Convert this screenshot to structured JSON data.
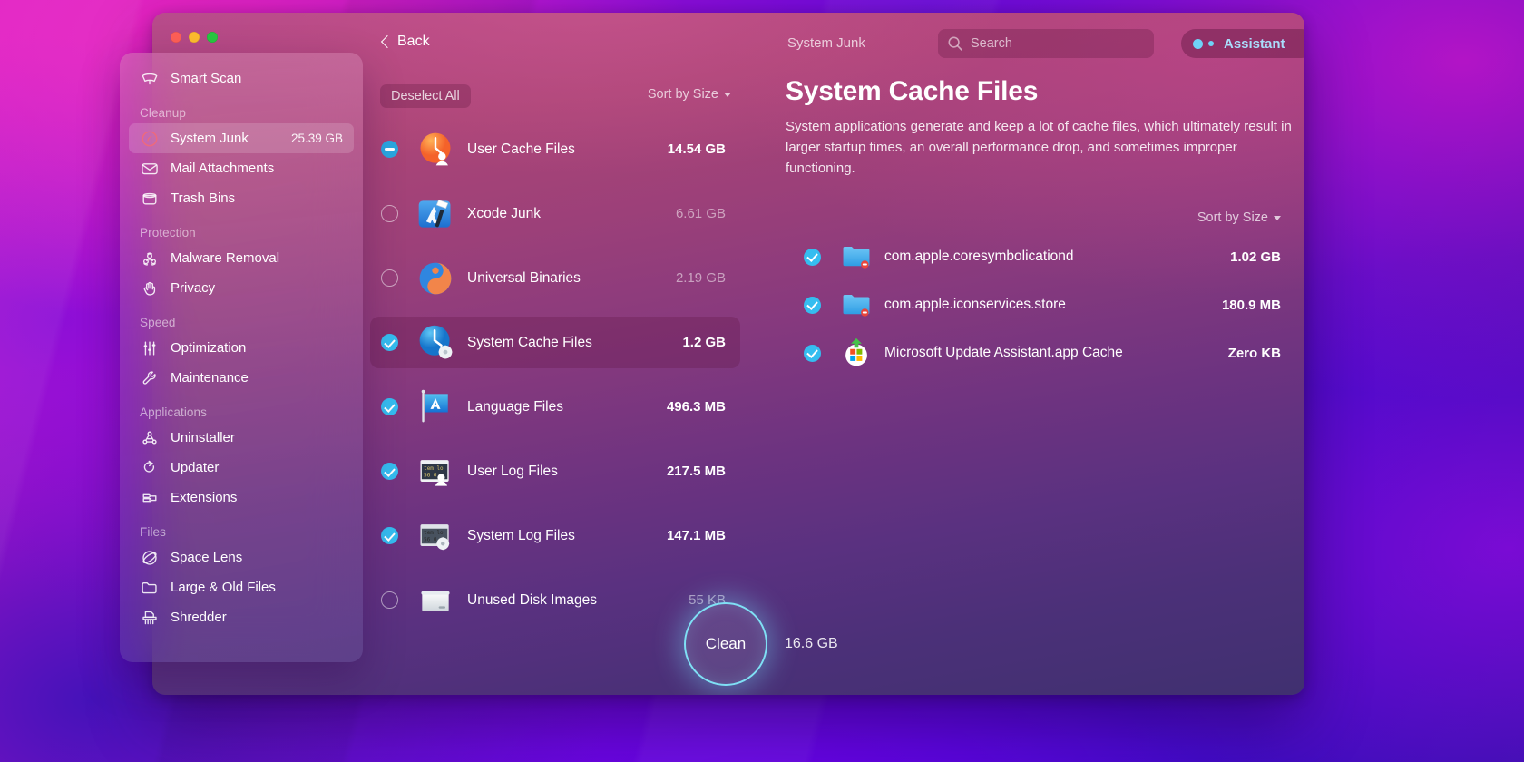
{
  "window": {
    "traffic_lights": [
      "close",
      "minimize",
      "zoom"
    ]
  },
  "topbar": {
    "back_label": "Back",
    "breadcrumb": "System Junk",
    "search_placeholder": "Search",
    "assistant_label": "Assistant"
  },
  "sidebar": {
    "top_item": {
      "label": "Smart Scan",
      "icon": "smart-scan-icon"
    },
    "groups": [
      {
        "title": "Cleanup",
        "items": [
          {
            "label": "System Junk",
            "icon": "system-junk-icon",
            "size": "25.39 GB",
            "selected": true
          },
          {
            "label": "Mail Attachments",
            "icon": "mail-icon",
            "size": "",
            "selected": false
          },
          {
            "label": "Trash Bins",
            "icon": "trash-icon",
            "size": "",
            "selected": false
          }
        ]
      },
      {
        "title": "Protection",
        "items": [
          {
            "label": "Malware Removal",
            "icon": "biohazard-icon",
            "size": "",
            "selected": false
          },
          {
            "label": "Privacy",
            "icon": "hand-icon",
            "size": "",
            "selected": false
          }
        ]
      },
      {
        "title": "Speed",
        "items": [
          {
            "label": "Optimization",
            "icon": "sliders-icon",
            "size": "",
            "selected": false
          },
          {
            "label": "Maintenance",
            "icon": "wrench-icon",
            "size": "",
            "selected": false
          }
        ]
      },
      {
        "title": "Applications",
        "items": [
          {
            "label": "Uninstaller",
            "icon": "uninstaller-icon",
            "size": "",
            "selected": false
          },
          {
            "label": "Updater",
            "icon": "updater-icon",
            "size": "",
            "selected": false
          },
          {
            "label": "Extensions",
            "icon": "extensions-icon",
            "size": "",
            "selected": false
          }
        ]
      },
      {
        "title": "Files",
        "items": [
          {
            "label": "Space Lens",
            "icon": "space-lens-icon",
            "size": "",
            "selected": false
          },
          {
            "label": "Large & Old Files",
            "icon": "folder-icon",
            "size": "",
            "selected": false
          },
          {
            "label": "Shredder",
            "icon": "shredder-icon",
            "size": "",
            "selected": false
          }
        ]
      }
    ]
  },
  "middle": {
    "deselect_all_label": "Deselect All",
    "sort_label": "Sort by Size",
    "rows": [
      {
        "name": "User Cache Files",
        "size": "14.54 GB",
        "state": "partial",
        "dim": false,
        "icon": "user-cache-icon"
      },
      {
        "name": "Xcode Junk",
        "size": "6.61 GB",
        "state": "off",
        "dim": true,
        "icon": "xcode-icon"
      },
      {
        "name": "Universal Binaries",
        "size": "2.19 GB",
        "state": "off",
        "dim": true,
        "icon": "universal-binaries-icon"
      },
      {
        "name": "System Cache Files",
        "size": "1.2 GB",
        "state": "on",
        "dim": false,
        "icon": "system-cache-icon",
        "selected": true
      },
      {
        "name": "Language Files",
        "size": "496.3 MB",
        "state": "on",
        "dim": false,
        "icon": "language-files-icon"
      },
      {
        "name": "User Log Files",
        "size": "217.5 MB",
        "state": "on",
        "dim": false,
        "icon": "user-log-icon"
      },
      {
        "name": "System Log Files",
        "size": "147.1 MB",
        "state": "on",
        "dim": false,
        "icon": "system-log-icon"
      },
      {
        "name": "Unused Disk Images",
        "size": "55 KB",
        "state": "off",
        "dim": true,
        "icon": "disk-image-icon"
      }
    ]
  },
  "detail": {
    "title": "System Cache Files",
    "description": "System applications generate and keep a lot of cache files, which ultimately result in larger startup times, an overall performance drop, and sometimes improper functioning.",
    "sort_label": "Sort by Size",
    "rows": [
      {
        "name": "com.apple.coresymbolicationd",
        "size": "1.02 GB",
        "state": "on",
        "icon": "blue-folder-icon"
      },
      {
        "name": "com.apple.iconservices.store",
        "size": "180.9 MB",
        "state": "on",
        "icon": "blue-folder-icon"
      },
      {
        "name": "Microsoft Update Assistant.app Cache",
        "size": "Zero KB",
        "state": "on",
        "icon": "microsoft-update-icon"
      }
    ]
  },
  "footer": {
    "clean_label": "Clean",
    "clean_size": "16.6 GB"
  },
  "colors": {
    "accent_cyan": "#35bdf0",
    "clean_ring": "#7fe0f5",
    "assistant_text": "#a9ddfb"
  }
}
